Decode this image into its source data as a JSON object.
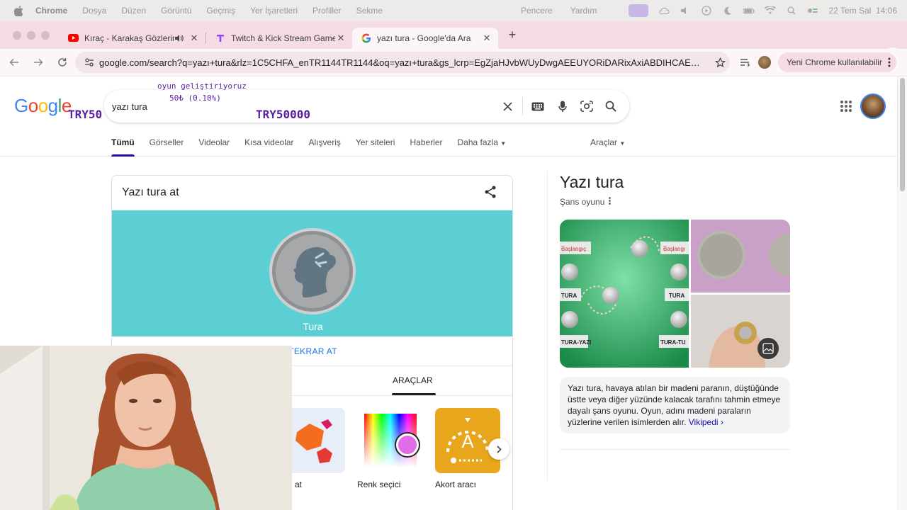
{
  "menubar": {
    "app": "Chrome",
    "items": [
      "Dosya",
      "Düzen",
      "Görüntü",
      "Geçmiş",
      "Yer İşaretleri",
      "Profiller",
      "Sekme"
    ],
    "right_items": [
      "Pencere",
      "Yardım"
    ],
    "clock": "22 Tem Sal  14:06"
  },
  "tabs": [
    {
      "title": "Kıraç - Karakaş Gözlerin E",
      "icon": "youtube-icon",
      "playing_audio": true
    },
    {
      "title": "Twitch & Kick Stream Games",
      "icon": "stream-games-icon"
    },
    {
      "title": "yazı tura - Google'da Ara",
      "icon": "google-icon",
      "active": true
    }
  ],
  "toolbar": {
    "url": "google.com/search?q=yazı+tura&rlz=1C5CHFA_enTR1144TR1144&oq=yazı+tura&gs_lcrp=EgZjaHJvbWUyDwgAEEUYORiDARixAxiABDIHCAEQABiA...",
    "update_label": "Yeni Chrome kullanılabilir"
  },
  "google": {
    "logo_letters": [
      "G",
      "o",
      "o",
      "g",
      "l",
      "e"
    ],
    "query": "yazı tura",
    "overlay": {
      "line1": "oyun geliştiriyoruz",
      "line2": "50₺ (0.10%)",
      "code_left": "TRY50",
      "code_center": "TRY50000"
    },
    "nav_tabs": [
      "Tümü",
      "Görseller",
      "Videolar",
      "Kısa videolar",
      "Alışveriş",
      "Yer siteleri",
      "Haberler",
      "Daha fazla"
    ],
    "tools_label": "Araçlar"
  },
  "coin_card": {
    "title": "Yazı tura at",
    "result": "Tura",
    "flip_again": "TEKRAR AT",
    "tab_active": "ARAÇLAR",
    "tools": [
      {
        "label": "at",
        "icon": "dice-icon"
      },
      {
        "label": "Renk seçici",
        "icon": "color-picker-icon"
      },
      {
        "label": "Akort aracı",
        "icon": "tuner-icon"
      }
    ]
  },
  "knowledge_panel": {
    "title": "Yazı tura",
    "subtitle": "Şans oyunu",
    "image_labels": [
      "Başlangıç",
      "Başlangı",
      "TURA",
      "TURA",
      "TURA-YAZI",
      "TURA-TU"
    ],
    "description": "Yazı tura, havaya atılan bir madeni paranın, düştüğünde üstte veya diğer yüzünde kalacak tarafını tahmin etmeye dayalı şans oyunu. Oyun, adını madeni paraların yüzlerine verilen isimlerden alır.",
    "source_link": "Vikipedi ›"
  }
}
